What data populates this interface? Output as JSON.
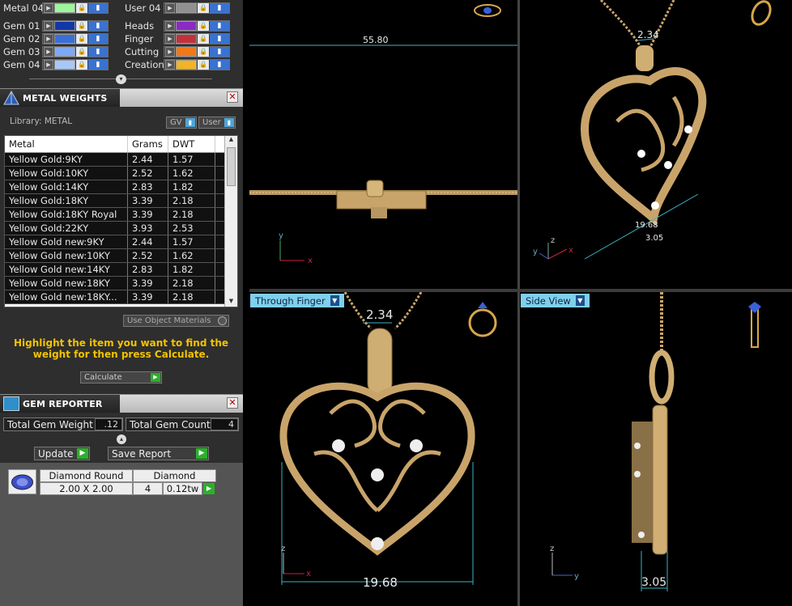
{
  "layers": {
    "left": [
      {
        "name": "Metal 04",
        "color": "#9ef59c"
      },
      {
        "name": "Gem 01",
        "color": "#1238a8"
      },
      {
        "name": "Gem 02",
        "color": "#3a6fd8"
      },
      {
        "name": "Gem 03",
        "color": "#7fa8f2"
      },
      {
        "name": "Gem 04",
        "color": "#a8c8f8"
      }
    ],
    "right": [
      {
        "name": "User 04",
        "color": "#909090"
      },
      {
        "name": "Heads",
        "color": "#8a2bc2"
      },
      {
        "name": "Finger",
        "color": "#c2323c"
      },
      {
        "name": "Cutting",
        "color": "#f07818"
      },
      {
        "name": "Creation",
        "color": "#f2b422"
      }
    ]
  },
  "metal_weights": {
    "title": "METAL WEIGHTS",
    "library_label": "Library: METAL",
    "toggle_gv": "GV",
    "toggle_user": "User",
    "columns": [
      "Metal",
      "Grams",
      "DWT"
    ],
    "rows": [
      [
        "Yellow Gold:9KY",
        "2.44",
        "1.57"
      ],
      [
        "Yellow Gold:10KY",
        "2.52",
        "1.62"
      ],
      [
        "Yellow Gold:14KY",
        "2.83",
        "1.82"
      ],
      [
        "Yellow Gold:18KY",
        "3.39",
        "2.18"
      ],
      [
        "Yellow Gold:18KY Royal",
        "3.39",
        "2.18"
      ],
      [
        "Yellow Gold:22KY",
        "3.93",
        "2.53"
      ],
      [
        "Yellow Gold new:9KY",
        "2.44",
        "1.57"
      ],
      [
        "Yellow Gold new:10KY",
        "2.52",
        "1.62"
      ],
      [
        "Yellow Gold new:14KY",
        "2.83",
        "1.82"
      ],
      [
        "Yellow Gold new:18KY",
        "3.39",
        "2.18"
      ],
      [
        "Yellow Gold new:18KY...",
        "3.39",
        "2.18"
      ]
    ],
    "use_object_materials": "Use Object Materials",
    "highlight_text": "Highlight the item you want to find the weight for then press Calculate.",
    "calculate_label": "Calculate"
  },
  "gem_reporter": {
    "title": "GEM REPORTER",
    "total_weight_label": "Total Gem Weight",
    "total_weight_value": ".12",
    "total_count_label": "Total Gem Count",
    "total_count_value": "4",
    "update_label": "Update",
    "save_report_label": "Save Report",
    "gem": {
      "shape": "Diamond Round",
      "material": "Diamond",
      "size": "2.00 X 2.00",
      "count": "4",
      "weight": "0.12tw"
    }
  },
  "viewports": {
    "top_left": {
      "dimension": "55.80"
    },
    "top_right": {
      "dimension_top": "2.34",
      "dimension_width": "19.68",
      "dimension_depth": "3.05"
    },
    "bottom_left": {
      "label": "Through Finger",
      "dimension_top": "2.34",
      "dimension_width": "19.68"
    },
    "bottom_right": {
      "label": "Side View",
      "dimension_depth": "3.05"
    }
  },
  "axes": {
    "x": "x",
    "y": "y",
    "z": "z"
  },
  "colors": {
    "gold": "#c9a46a",
    "accent_label": "#7fd0ec",
    "highlight_text": "#f2c300",
    "go_green": "#2bb02b"
  }
}
